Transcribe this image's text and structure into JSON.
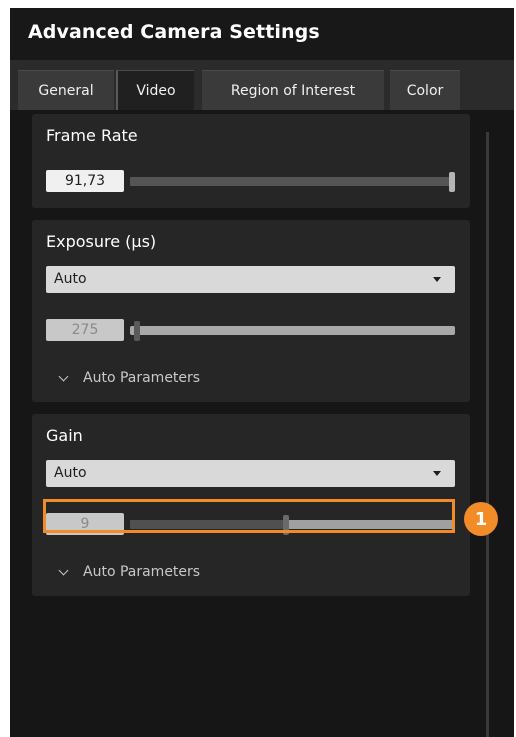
{
  "window": {
    "title": "Advanced Camera Settings"
  },
  "tabs": [
    {
      "label": "General",
      "active": false
    },
    {
      "label": "Video",
      "active": true
    },
    {
      "label": "Region of Interest",
      "active": false
    },
    {
      "label": "Color",
      "active": false
    }
  ],
  "frame_rate": {
    "title": "Frame Rate",
    "value": "91,73",
    "slider_fraction": 1.0
  },
  "exposure": {
    "title": "Exposure (µs)",
    "mode": "Auto",
    "value": "275",
    "slider_fraction": 0.02,
    "expander_label": "Auto Parameters"
  },
  "gain": {
    "title": "Gain",
    "mode": "Auto",
    "value": "9",
    "slider_fraction": 0.48,
    "expander_label": "Auto Parameters"
  },
  "annotation": {
    "number": "1",
    "color": "#f28c28"
  }
}
